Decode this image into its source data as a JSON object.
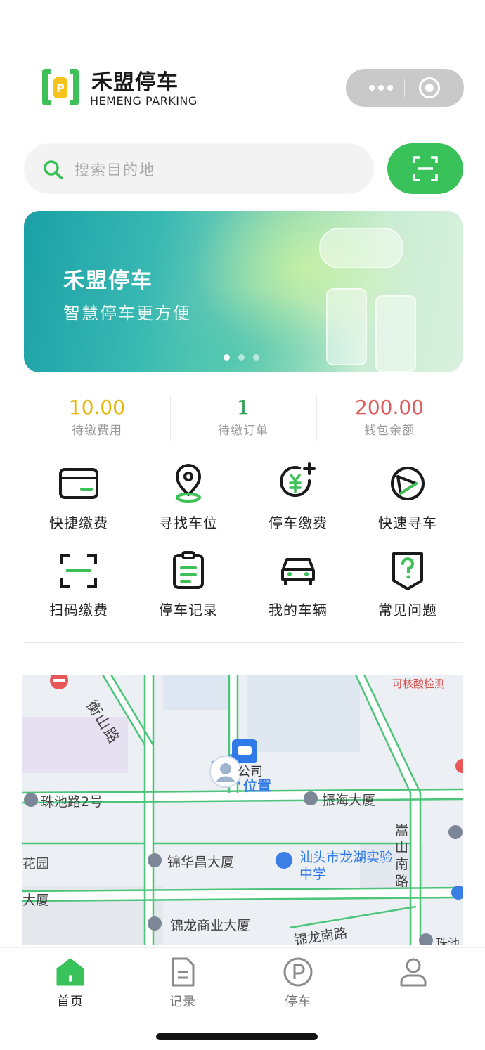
{
  "header": {
    "brand_name": "禾盟停车",
    "brand_sub": "HEMENG PARKING"
  },
  "search": {
    "placeholder": "搜索目的地"
  },
  "banner": {
    "title": "禾盟停车",
    "subtitle": "智慧停车更方便",
    "slide_count": 3,
    "active_slide": 1
  },
  "stats": [
    {
      "value": "10.00",
      "label": "待缴费用",
      "color": "#e8b500"
    },
    {
      "value": "1",
      "label": "待缴订单",
      "color": "#2f9e54"
    },
    {
      "value": "200.00",
      "label": "钱包余额",
      "color": "#e05a5a"
    }
  ],
  "features": [
    {
      "label": "快捷缴费",
      "icon": "card-icon"
    },
    {
      "label": "寻找车位",
      "icon": "location-pin-icon"
    },
    {
      "label": "停车缴费",
      "icon": "yuan-plus-icon"
    },
    {
      "label": "快速寻车",
      "icon": "compass-icon"
    },
    {
      "label": "扫码缴费",
      "icon": "scan-icon"
    },
    {
      "label": "停车记录",
      "icon": "clipboard-icon"
    },
    {
      "label": "我的车辆",
      "icon": "car-icon"
    },
    {
      "label": "常见问题",
      "icon": "question-icon"
    }
  ],
  "map": {
    "labels": {
      "hengshan_road": "衡山路",
      "zhuchi_road_2": "珠池路2号",
      "zhenhai_building": "振海大厦",
      "songshan_south_road": "嵩山南路",
      "jinhuachang_building": "锦华昌大厦",
      "longhu_school": "汕头市龙湖实验中学",
      "jinlong_commercial": "锦龙商业大厦",
      "jinlong_south_road": "锦龙南路",
      "nucleic_test": "可核酸检测",
      "flower_garden": "花园",
      "building_left": "大厦",
      "company_fragment": "公司",
      "my_location": "位置",
      "zhuchi_fragment": "珠池"
    }
  },
  "tabbar": {
    "items": [
      {
        "label": "首页",
        "icon": "home-icon",
        "active": true
      },
      {
        "label": "记录",
        "icon": "document-icon",
        "active": false
      },
      {
        "label": "停车",
        "icon": "parking-icon",
        "active": false
      },
      {
        "label": "",
        "icon": "user-icon",
        "active": false
      }
    ]
  },
  "colors": {
    "accent": "#39c15a",
    "pending_fee": "#e8b500",
    "pending_order": "#2f9e54",
    "wallet": "#e05a5a"
  }
}
